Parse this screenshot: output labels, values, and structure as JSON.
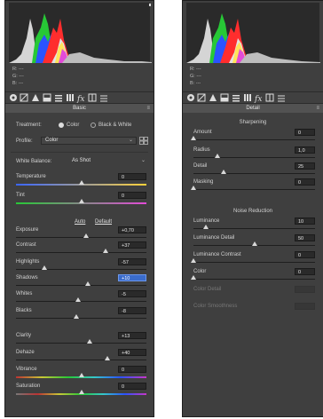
{
  "rgb_readout": {
    "r_label": "R:",
    "r_value": "---",
    "g_label": "G:",
    "g_value": "---",
    "b_label": "B:",
    "b_value": "---"
  },
  "basic": {
    "title": "Basic",
    "treatment_label": "Treatment:",
    "treatment_options": [
      "Color",
      "Black & White"
    ],
    "treatment_selected": "Color",
    "profile_label": "Profile:",
    "profile_value": "Color",
    "white_balance_label": "White Balance:",
    "white_balance_value": "As Shot",
    "auto_label": "Auto",
    "default_label": "Default",
    "sliders": [
      {
        "label": "Temperature",
        "value": "0",
        "pos": 0.5
      },
      {
        "label": "Tint",
        "value": "0",
        "pos": 0.5
      },
      {
        "label": "Exposure",
        "value": "+0,70",
        "pos": 0.535
      },
      {
        "label": "Contrast",
        "value": "+37",
        "pos": 0.685
      },
      {
        "label": "Highlights",
        "value": "-57",
        "pos": 0.215
      },
      {
        "label": "Shadows",
        "value": "+10",
        "pos": 0.55
      },
      {
        "label": "Whites",
        "value": "-5",
        "pos": 0.475
      },
      {
        "label": "Blacks",
        "value": "-8",
        "pos": 0.46
      },
      {
        "label": "Clarity",
        "value": "+13",
        "pos": 0.565
      },
      {
        "label": "Dehaze",
        "value": "+40",
        "pos": 0.7
      },
      {
        "label": "Vibrance",
        "value": "0",
        "pos": 0.5
      },
      {
        "label": "Saturation",
        "value": "0",
        "pos": 0.5
      }
    ],
    "selected_field": "Shadows"
  },
  "detail": {
    "title": "Detail",
    "sharpening_title": "Sharpening",
    "sharpening": [
      {
        "label": "Amount",
        "value": "0",
        "pos": 0.0
      },
      {
        "label": "Radius",
        "value": "1,0",
        "pos": 0.2
      },
      {
        "label": "Detail",
        "value": "25",
        "pos": 0.25
      },
      {
        "label": "Masking",
        "value": "0",
        "pos": 0.0
      }
    ],
    "noise_title": "Noise Reduction",
    "noise": [
      {
        "label": "Luminance",
        "value": "10",
        "pos": 0.1
      },
      {
        "label": "Luminance Detail",
        "value": "50",
        "pos": 0.5
      },
      {
        "label": "Luminance Contrast",
        "value": "0",
        "pos": 0.0
      },
      {
        "label": "Color",
        "value": "0",
        "pos": 0.0
      }
    ],
    "disabled": [
      {
        "label": "Color Detail"
      },
      {
        "label": "Color Smoothness"
      }
    ]
  },
  "icons": [
    "histogram-icon",
    "hsl-icon",
    "tone-curve-icon",
    "split-toning-icon",
    "detail-icon",
    "lens-icon",
    "fx-icon",
    "calibration-icon",
    "presets-icon"
  ],
  "colors": {
    "panel": "#3f3f3f",
    "selection": "#3a6ccc"
  }
}
